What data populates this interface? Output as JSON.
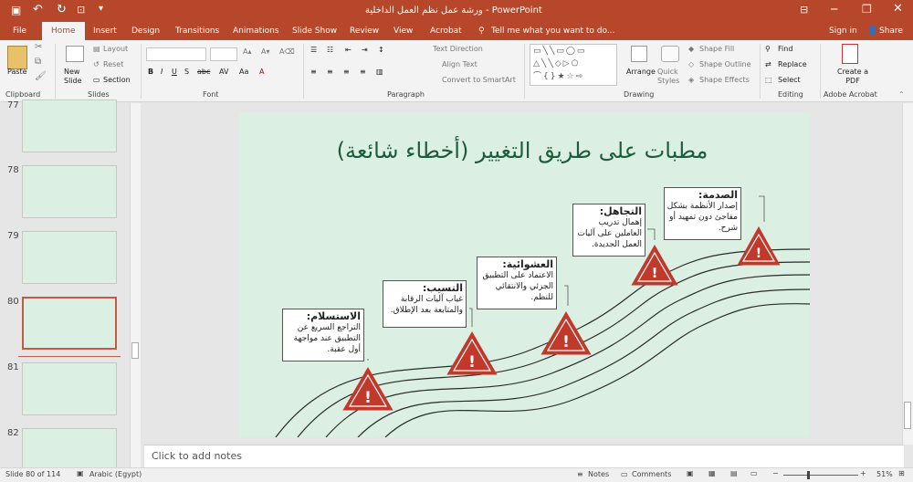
{
  "app": {
    "window_title": "ورشة عمل نظم العمل الداخلية - PowerPoint",
    "signin": "Sign in",
    "share": "Share",
    "tell_me": "Tell me what you want to do..."
  },
  "tabs": [
    "File",
    "Home",
    "Insert",
    "Design",
    "Transitions",
    "Animations",
    "Slide Show",
    "Review",
    "View",
    "Acrobat"
  ],
  "ribbon": {
    "clipboard": {
      "label": "Clipboard",
      "paste": "Paste"
    },
    "slides": {
      "label": "Slides",
      "new_slide": "New Slide",
      "layout": "Layout",
      "reset": "Reset",
      "section": "Section"
    },
    "font": {
      "label": "Font"
    },
    "paragraph": {
      "label": "Paragraph",
      "text_direction": "Text Direction",
      "align_text": "Align Text",
      "convert_smartart": "Convert to SmartArt"
    },
    "drawing": {
      "label": "Drawing",
      "arrange": "Arrange",
      "quick_styles": "Quick Styles",
      "shape_fill": "Shape Fill",
      "shape_outline": "Shape Outline",
      "shape_effects": "Shape Effects"
    },
    "editing": {
      "label": "Editing",
      "find": "Find",
      "replace": "Replace",
      "select": "Select"
    },
    "acrobat": {
      "label": "Adobe Acrobat",
      "create_pdf": "Create a PDF"
    }
  },
  "thumbnails": [
    {
      "num": "77"
    },
    {
      "num": "78"
    },
    {
      "num": "79"
    },
    {
      "num": "80"
    },
    {
      "num": "81"
    },
    {
      "num": "82"
    }
  ],
  "slide": {
    "title": "مطبات على طريق التغيير (أخطاء شائعة)",
    "boxes": [
      {
        "heading": "الصدمة:",
        "body": "إصدار الأنظمة بشكل مفاجئ دون تمهيد أو شرح."
      },
      {
        "heading": "التجاهل:",
        "body": "إهمال تدريب العاملين على آليات العمل الجديدة."
      },
      {
        "heading": "العشوائية:",
        "body": "الاعتماد على التطبيق الجزئي والانتقائي للنظم."
      },
      {
        "heading": "التسيب:",
        "body": "غياب آليات الرقابة والمتابعة بعد الإطلاق."
      },
      {
        "heading": "الاستسلام:",
        "body": "التراجع السريع عن التطبيق عند مواجهة أول عقبة."
      }
    ]
  },
  "notes_placeholder": "Click to add notes",
  "status": {
    "slide_of": "Slide 80 of 114",
    "language": "Arabic (Egypt)",
    "notes": "Notes",
    "comments": "Comments",
    "zoom": "51%"
  },
  "colors": {
    "accent": "#b7472a",
    "warning": "#c0392b",
    "title": "#1d5c3a"
  }
}
